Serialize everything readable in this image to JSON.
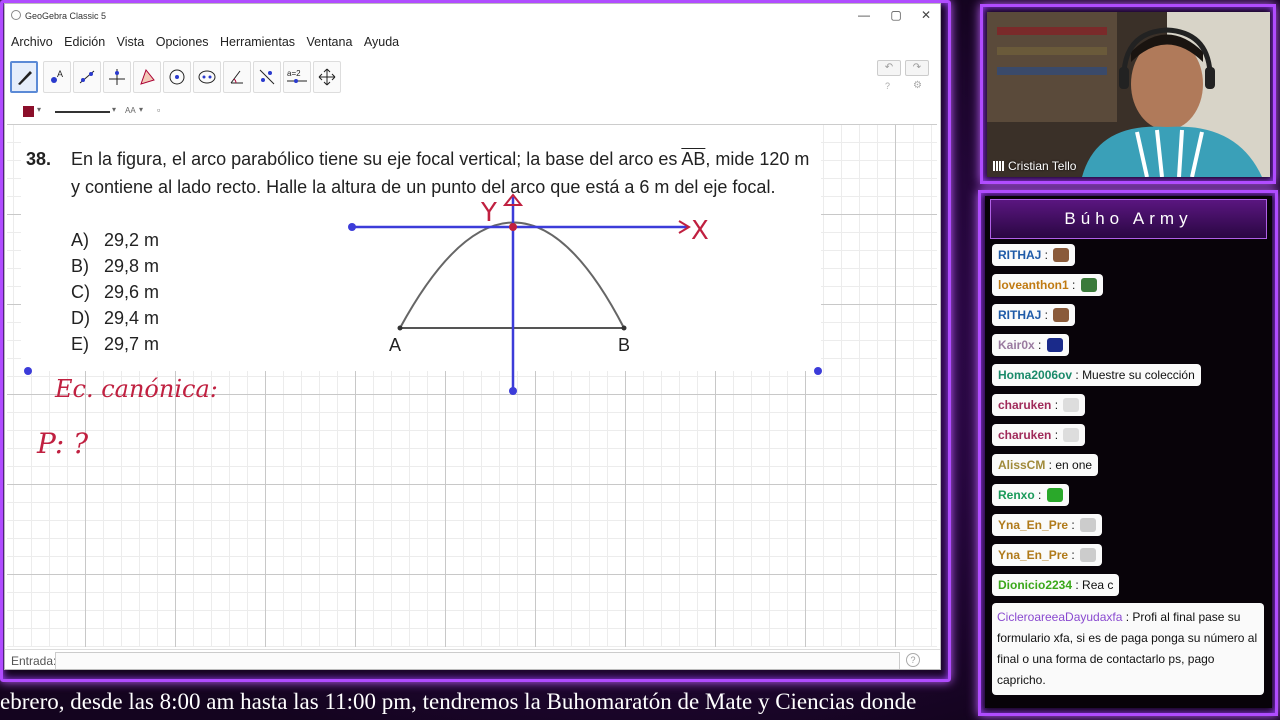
{
  "app": {
    "window_title": "GeoGebra Classic 5",
    "window_buttons": [
      "—",
      "▢",
      "✕"
    ],
    "menu": [
      "Archivo",
      "Edición",
      "Vista",
      "Opciones",
      "Herramientas",
      "Ventana",
      "Ayuda"
    ],
    "tools": [
      "move",
      "point",
      "line",
      "perpendicular",
      "polygon",
      "circle",
      "conic",
      "angle",
      "reflect",
      "slider",
      "move-graphics"
    ],
    "tool_slider_label": "a=2",
    "undo_redo": [
      "↶",
      "↷"
    ],
    "style_bar": {
      "color": "#8b0e2a",
      "font_size": "AA"
    },
    "input_label": "Entrada:",
    "help": "?"
  },
  "problem": {
    "number": "38.",
    "line1_pre": "En la figura, el arco parabólico tiene su eje focal vertical; la base del arco es",
    "line1_seg": "AB",
    "line1_post": ", mide 120 m",
    "line2": "y contiene al lado recto. Halle la altura de un punto del arco que está a 6 m del eje focal.",
    "options": [
      {
        "letter": "A)",
        "value": "29,2 m"
      },
      {
        "letter": "B)",
        "value": "29,8 m"
      },
      {
        "letter": "C)",
        "value": "29,6 m"
      },
      {
        "letter": "D)",
        "value": "29,4 m"
      },
      {
        "letter": "E)",
        "value": "29,7 m"
      }
    ],
    "point_a": "A",
    "point_b": "B",
    "handwritten_axis_x": "X",
    "handwritten_axis_y": "Y",
    "handwritten_note_1": "Ec. canónica:",
    "handwritten_note_2": "P: ?"
  },
  "stream": {
    "streamer_name": "Cristian Tello",
    "chat_title": "Búho Army",
    "ticker": "ebrero, desde las 8:00 am hasta las 11:00 pm, tendremos la Buhomaratón de Mate y Ciencias donde",
    "chat": [
      {
        "user": "RITHAJ",
        "color": "#1e5aa8",
        "text": "",
        "emoji": "#8a5a3a"
      },
      {
        "user": "loveanthon1",
        "color": "#c07a12",
        "text": "",
        "emoji": "#3a7a3a"
      },
      {
        "user": "RITHAJ",
        "color": "#1e5aa8",
        "text": "",
        "emoji": "#8a5a3a"
      },
      {
        "user": "Kair0x",
        "color": "#9a7aa0",
        "text": "",
        "emoji": "#1a2a8a"
      },
      {
        "user": "Homa2006ov",
        "color": "#1a8a6a",
        "text": "Muestre su colección",
        "emoji": ""
      },
      {
        "user": "charuken",
        "color": "#a02a5a",
        "text": "",
        "emoji": "#dddddd"
      },
      {
        "user": "charuken",
        "color": "#a02a5a",
        "text": "",
        "emoji": "#dddddd"
      },
      {
        "user": "AlissCM",
        "color": "#a08a3a",
        "text": "en one",
        "emoji": ""
      },
      {
        "user": "Renxo",
        "color": "#1a9a5a",
        "text": "",
        "emoji": "#2aa82a"
      },
      {
        "user": "Yna_En_Pre",
        "color": "#b07a1a",
        "text": "",
        "emoji": "#cccccc"
      },
      {
        "user": "Yna_En_Pre",
        "color": "#b07a1a",
        "text": "",
        "emoji": "#cccccc"
      },
      {
        "user": "Dionicio2234",
        "color": "#3aa81a",
        "text": "Rea c",
        "emoji": ""
      }
    ],
    "long_message": {
      "user": "CicleroareeaDayudaxfa",
      "color": "#8a4ad0",
      "text": "Profi al final pase su formulario xfa, si es de paga ponga su número al final o una forma de contactarlo ps, pago capricho."
    }
  }
}
